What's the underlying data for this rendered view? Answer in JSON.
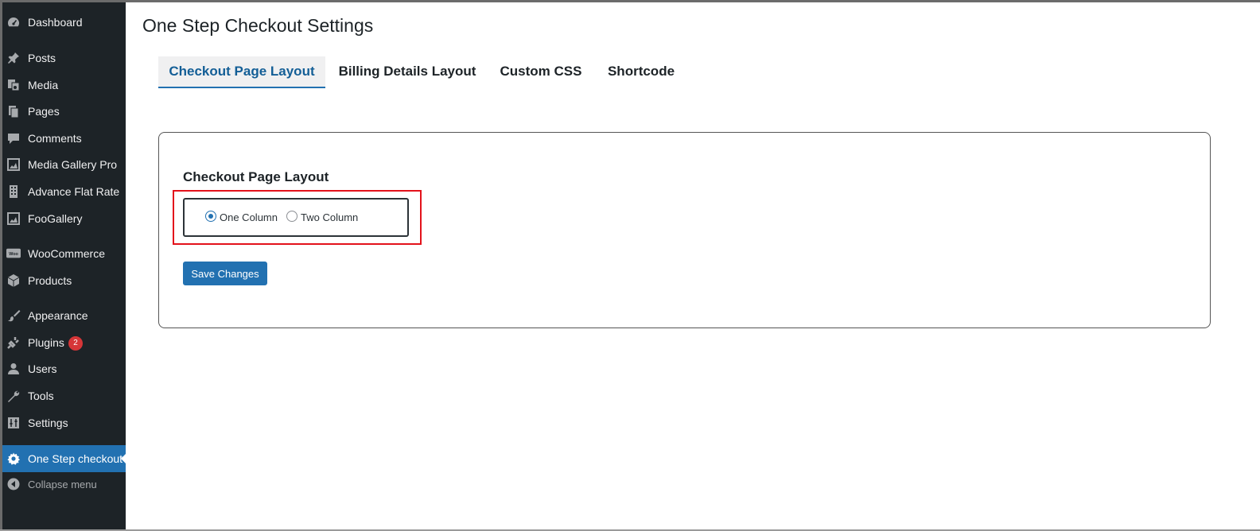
{
  "sidebar": {
    "items": [
      {
        "label": "Dashboard",
        "icon": "dashboard-icon"
      },
      {
        "label": "Posts",
        "icon": "pin-icon"
      },
      {
        "label": "Media",
        "icon": "media-icon"
      },
      {
        "label": "Pages",
        "icon": "pages-icon"
      },
      {
        "label": "Comments",
        "icon": "comment-icon"
      },
      {
        "label": "Media Gallery Pro",
        "icon": "gallery-icon"
      },
      {
        "label": "Advance Flat Rate",
        "icon": "building-icon"
      },
      {
        "label": "FooGallery",
        "icon": "gallery-icon"
      },
      {
        "label": "WooCommerce",
        "icon": "woo-icon"
      },
      {
        "label": "Products",
        "icon": "box-icon"
      },
      {
        "label": "Appearance",
        "icon": "brush-icon"
      },
      {
        "label": "Plugins",
        "icon": "plug-icon"
      },
      {
        "label": "Users",
        "icon": "user-icon"
      },
      {
        "label": "Tools",
        "icon": "wrench-icon"
      },
      {
        "label": "Settings",
        "icon": "settings-sliders-icon"
      },
      {
        "label": "One Step checkout",
        "icon": "gear-icon"
      }
    ],
    "plugins_badge": "2",
    "collapse_label": "Collapse menu"
  },
  "page": {
    "title": "One Step Checkout Settings"
  },
  "tabs": [
    {
      "label": "Checkout Page Layout",
      "active": true
    },
    {
      "label": "Billing Details Layout",
      "active": false
    },
    {
      "label": "Custom CSS",
      "active": false
    },
    {
      "label": "Shortcode",
      "active": false
    }
  ],
  "panel": {
    "heading": "Checkout Page Layout",
    "options": [
      {
        "label": "One Column",
        "checked": true
      },
      {
        "label": "Two Column",
        "checked": false
      }
    ],
    "save_label": "Save Changes"
  },
  "colors": {
    "sidebar_bg": "#1d2327",
    "accent": "#2271b1",
    "highlight": "#e3121b",
    "badge": "#d63638"
  }
}
